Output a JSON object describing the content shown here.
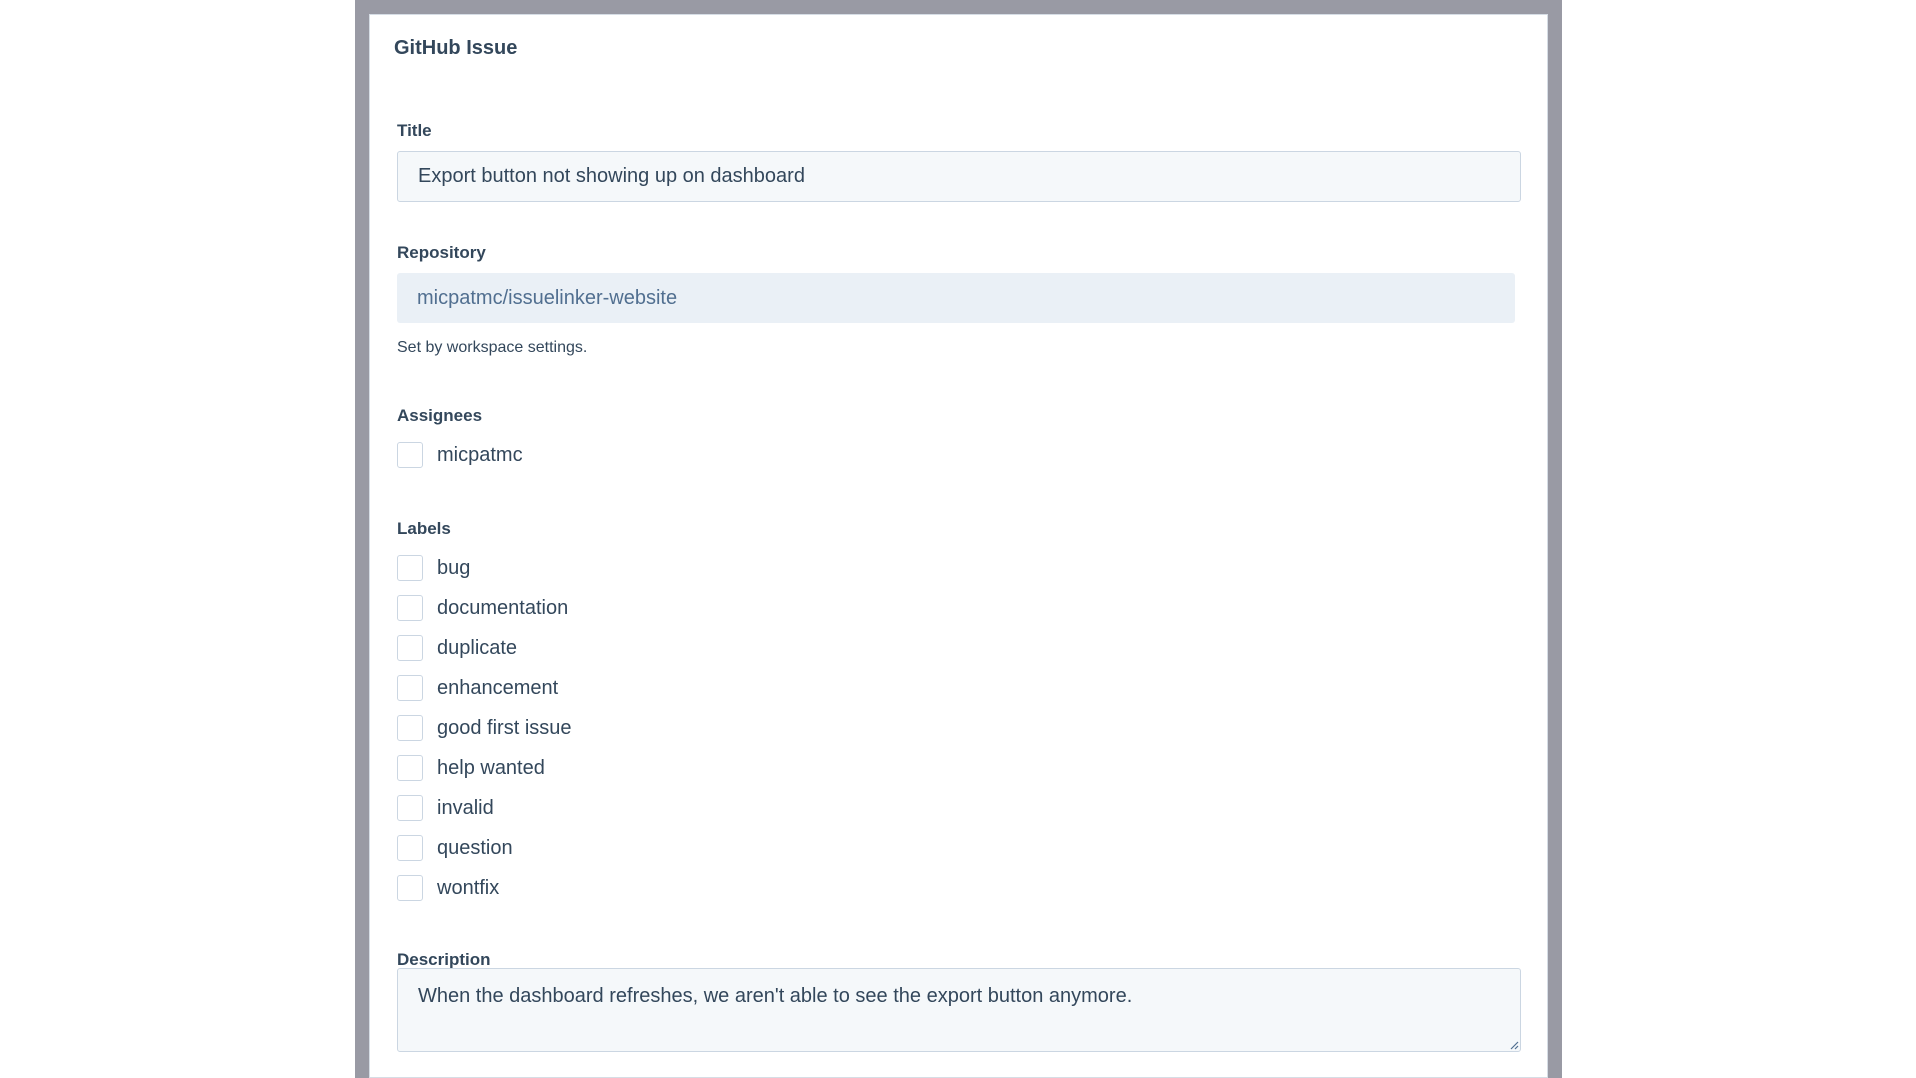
{
  "card": {
    "title": "GitHub Issue"
  },
  "title_field": {
    "label": "Title",
    "value": "Export button not showing up on dashboard"
  },
  "repository_field": {
    "label": "Repository",
    "value": "micpatmc/issuelinker-website",
    "help": "Set by workspace settings."
  },
  "assignees": {
    "label": "Assignees",
    "options": [
      {
        "label": "micpatmc",
        "checked": false
      }
    ]
  },
  "labels": {
    "label": "Labels",
    "options": [
      {
        "label": "bug",
        "checked": false
      },
      {
        "label": "documentation",
        "checked": false
      },
      {
        "label": "duplicate",
        "checked": false
      },
      {
        "label": "enhancement",
        "checked": false
      },
      {
        "label": "good first issue",
        "checked": false
      },
      {
        "label": "help wanted",
        "checked": false
      },
      {
        "label": "invalid",
        "checked": false
      },
      {
        "label": "question",
        "checked": false
      },
      {
        "label": "wontfix",
        "checked": false
      }
    ]
  },
  "description_field": {
    "label": "Description",
    "value": "When the dashboard refreshes, we aren't able to see the export button anymore."
  },
  "colors": {
    "frame": "#999aa4",
    "text": "#33475b",
    "input_bg": "#f5f8fa",
    "readonly_bg": "#eaf0f6",
    "border": "#cbd6e2"
  },
  "icons": {
    "resize_grip": "resize-grip-icon"
  }
}
